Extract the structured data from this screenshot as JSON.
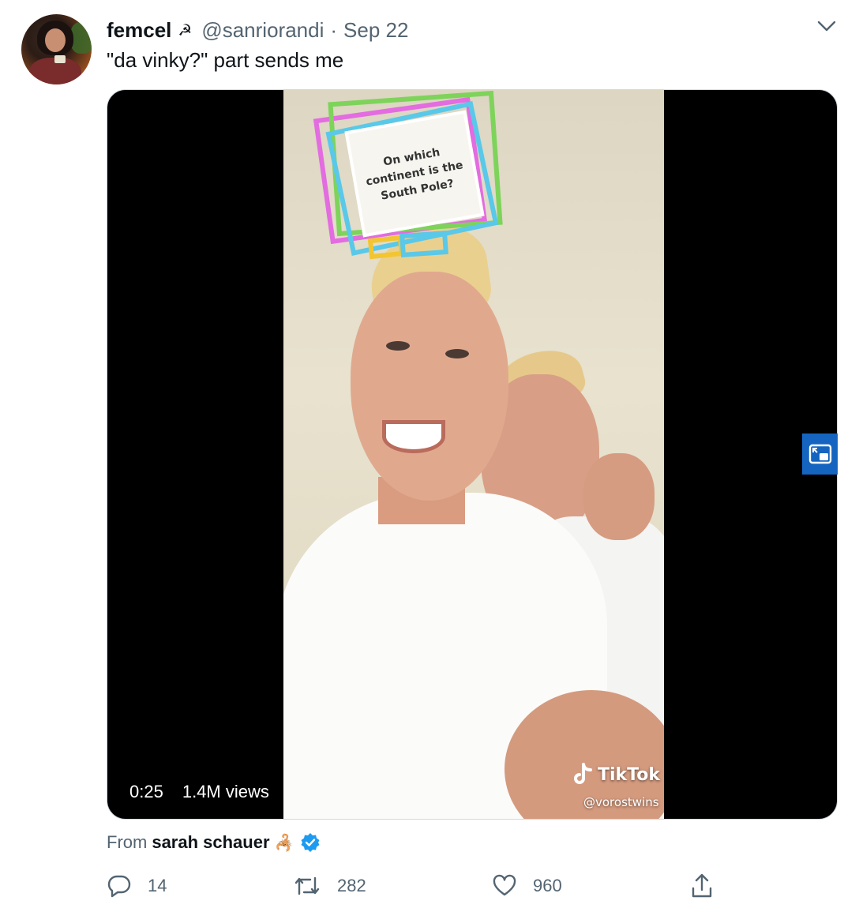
{
  "tweet": {
    "author_name": "femcel",
    "author_emoji": "☭",
    "handle": "@sanriorandi",
    "separator": "·",
    "date": "Sep 22",
    "text": "\"da vinky?\" part sends me"
  },
  "media": {
    "duration": "0:25",
    "views": "1.4M views",
    "quiz_text": "On which continent is the South Pole?",
    "watermark_brand": "TikTok",
    "watermark_handle": "@vorostwins"
  },
  "source": {
    "from_label": "From",
    "from_name": "sarah schauer",
    "from_emoji": "🦂"
  },
  "actions": {
    "reply_count": "14",
    "retweet_count": "282",
    "like_count": "960"
  },
  "icons": {
    "caret": "chevron-down-icon",
    "reply": "reply-icon",
    "retweet": "retweet-icon",
    "like": "heart-icon",
    "share": "share-icon",
    "pip": "picture-in-picture-icon",
    "verified": "verified-badge-icon"
  },
  "colors": {
    "secondary_text": "#536471",
    "verified": "#1d9bf0",
    "pip_button": "#1565c0"
  }
}
